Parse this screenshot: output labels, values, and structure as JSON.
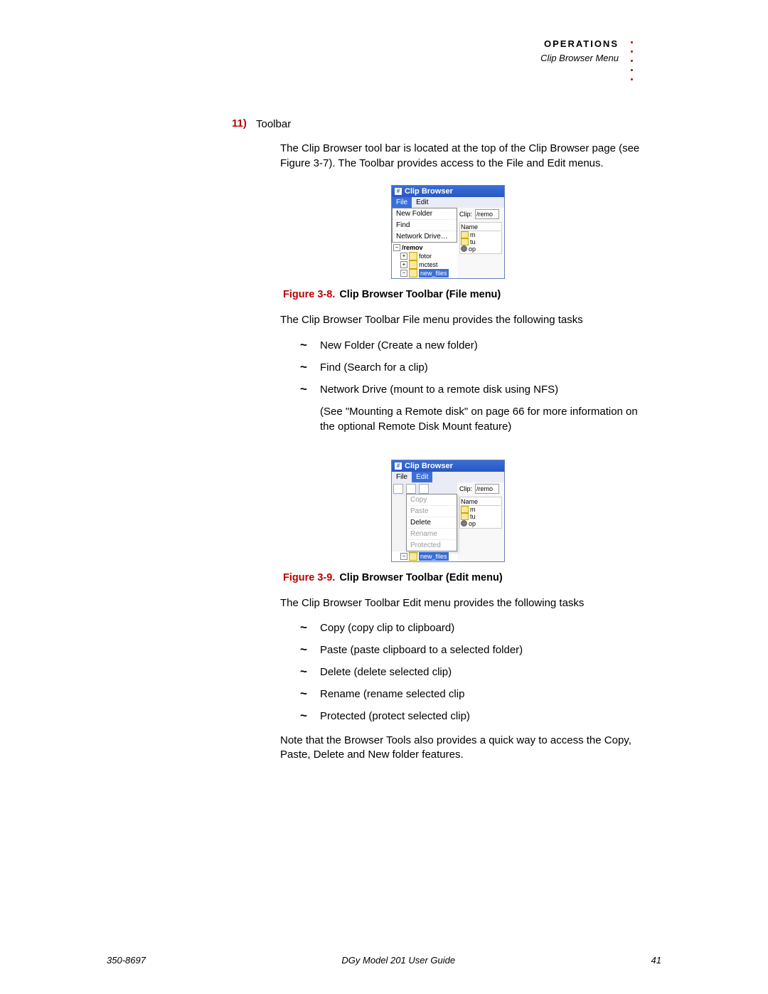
{
  "header": {
    "section": "OPERATIONS",
    "subtitle": "Clip Browser Menu"
  },
  "step": {
    "number": "11)",
    "title": "Toolbar",
    "intro": "The Clip Browser tool bar is located at the top of the Clip Browser page (see Figure 3-7). The Toolbar provides access to the File and Edit menus."
  },
  "figure8": {
    "label": "Figure 3-8.",
    "title": "Clip Browser Toolbar (File menu)",
    "window_title": "Clip Browser",
    "menu": {
      "file": "File",
      "edit": "Edit"
    },
    "dropdown": [
      "New Folder",
      "Find",
      "Network Drive…"
    ],
    "tree": {
      "root": "/remov",
      "items": [
        "fotor",
        "mctest",
        "new_files"
      ]
    },
    "clip_label": "Clip:",
    "clip_value": "/remo",
    "name_header": "Name",
    "rows": [
      "m",
      "tu",
      "op"
    ]
  },
  "file_menu_intro": "The Clip Browser Toolbar File menu provides the following tasks",
  "file_menu_items": [
    "New Folder (Create a new folder)",
    "Find (Search for a clip)",
    "Network Drive (mount to a remote disk using NFS)"
  ],
  "file_menu_note": "(See \"Mounting a Remote disk\" on page 66 for more information on the optional Remote Disk Mount feature)",
  "figure9": {
    "label": "Figure 3-9.",
    "title": "Clip Browser Toolbar (Edit menu)",
    "window_title": "Clip Browser",
    "menu": {
      "file": "File",
      "edit": "Edit"
    },
    "dropdown": [
      {
        "label": "Copy",
        "disabled": true
      },
      {
        "label": "Paste",
        "disabled": true
      },
      {
        "label": "Delete",
        "disabled": false
      },
      {
        "label": "Rename",
        "disabled": true
      },
      {
        "label": "Protected",
        "disabled": true
      }
    ],
    "tree_selected": "new_files",
    "clip_label": "Clip:",
    "clip_value": "/remo",
    "name_header": "Name",
    "rows": [
      "m",
      "tu",
      "op"
    ]
  },
  "edit_menu_intro": "The Clip Browser Toolbar Edit menu provides the following tasks",
  "edit_menu_items": [
    "Copy (copy clip to clipboard)",
    "Paste (paste clipboard to a selected folder)",
    "Delete (delete selected clip)",
    "Rename (rename selected clip",
    "Protected (protect selected clip)"
  ],
  "closing_note": "Note that the Browser Tools also provides a quick way to access the Copy, Paste, Delete and New folder features.",
  "footer": {
    "left": "350-8697",
    "center": "DGy Model 201 User Guide",
    "right": "41"
  }
}
